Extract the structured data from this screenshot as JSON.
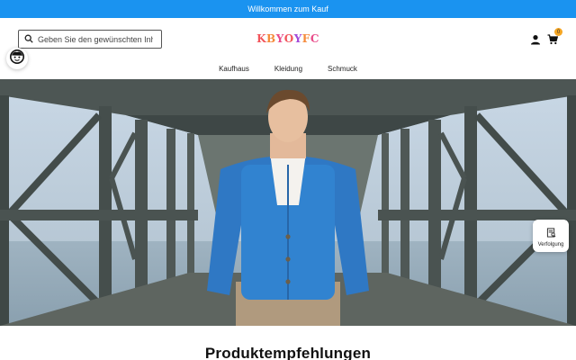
{
  "topbar": {
    "text": "Willkommen zum Kauf",
    "bg": "#1a93f0"
  },
  "header": {
    "search": {
      "placeholder": "Geben Sie den gewünschten Inh",
      "icon": "search-icon"
    },
    "logo": {
      "text": "KBYOYFC",
      "colors": [
        "#f2555b",
        "#f58a3a",
        "#e94b8a",
        "#f2555b",
        "#a34bd9",
        "#f58a3a",
        "#e94b8a"
      ]
    },
    "icons": {
      "user": "user-icon",
      "cart": "cart-icon"
    },
    "cart_count": "0"
  },
  "nav": {
    "items": [
      "Kaufhaus",
      "Kleidung",
      "Schmuck"
    ]
  },
  "floating": {
    "face_icon": "face-icon",
    "tracking_label": "Verfolgung",
    "tracking_icon": "tracking-icon"
  },
  "hero": {
    "image": "man-in-blue-cardigan-on-bridge"
  },
  "section": {
    "title": "Produktempfehlungen"
  }
}
